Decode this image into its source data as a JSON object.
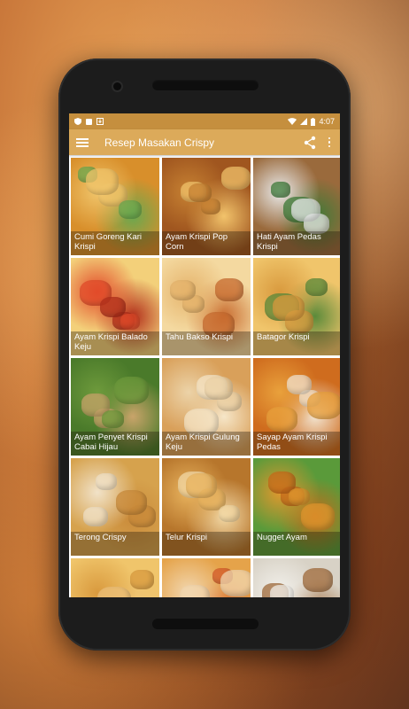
{
  "status_bar": {
    "time": "4:07"
  },
  "app_bar": {
    "title": "Resep Masakan Crispy"
  },
  "recipes": [
    {
      "label": "Cumi Goreng Kari Krispi",
      "bg": [
        "#f0c56b",
        "#d88f2b",
        "#6aa84f"
      ]
    },
    {
      "label": "Ayam Krispi Pop Corn",
      "bg": [
        "#c78233",
        "#a0561f",
        "#f2c36b"
      ]
    },
    {
      "label": "Hati Ayam Pedas Krispi",
      "bg": [
        "#e9eaea",
        "#9a6a3c",
        "#3d7a38"
      ]
    },
    {
      "label": "Ayam Krispi Balado Keju",
      "bg": [
        "#e24b2a",
        "#f3d07a",
        "#b22e1a"
      ]
    },
    {
      "label": "Tahu Bakso Krispi",
      "bg": [
        "#e5b36b",
        "#f4d9a0",
        "#c86b2f"
      ]
    },
    {
      "label": "Batagor Krispi",
      "bg": [
        "#d99a3e",
        "#f0c56b",
        "#5b8a3a"
      ]
    },
    {
      "label": "Ayam Penyet Krispi Cabai Hijau",
      "bg": [
        "#6e9a3c",
        "#4a7a2a",
        "#c9a46a"
      ]
    },
    {
      "label": "Ayam Krispi Gulung Keju",
      "bg": [
        "#ecd3a8",
        "#d9a05a",
        "#f6e6c8"
      ]
    },
    {
      "label": "Sayap Ayam Krispi Pedas",
      "bg": [
        "#e9a13c",
        "#cf6c1e",
        "#f2e4d0"
      ]
    },
    {
      "label": "Terong Crispy",
      "bg": [
        "#f1e2c8",
        "#d6a24d",
        "#c98a3a"
      ]
    },
    {
      "label": "Telur Krispi",
      "bg": [
        "#e9b45f",
        "#b7762c",
        "#f3d9a6"
      ]
    },
    {
      "label": "Nugget Ayam",
      "bg": [
        "#e0972e",
        "#5a9a3a",
        "#c86a1a"
      ]
    },
    {
      "label": "",
      "bg": [
        "#d99a3e",
        "#f0c56b",
        "#ecc07a"
      ]
    },
    {
      "label": "",
      "bg": [
        "#f2d7b0",
        "#e5a34a",
        "#d45a2a"
      ]
    },
    {
      "label": "",
      "bg": [
        "#f3f1ec",
        "#d8d2c6",
        "#a06a3a"
      ]
    }
  ]
}
